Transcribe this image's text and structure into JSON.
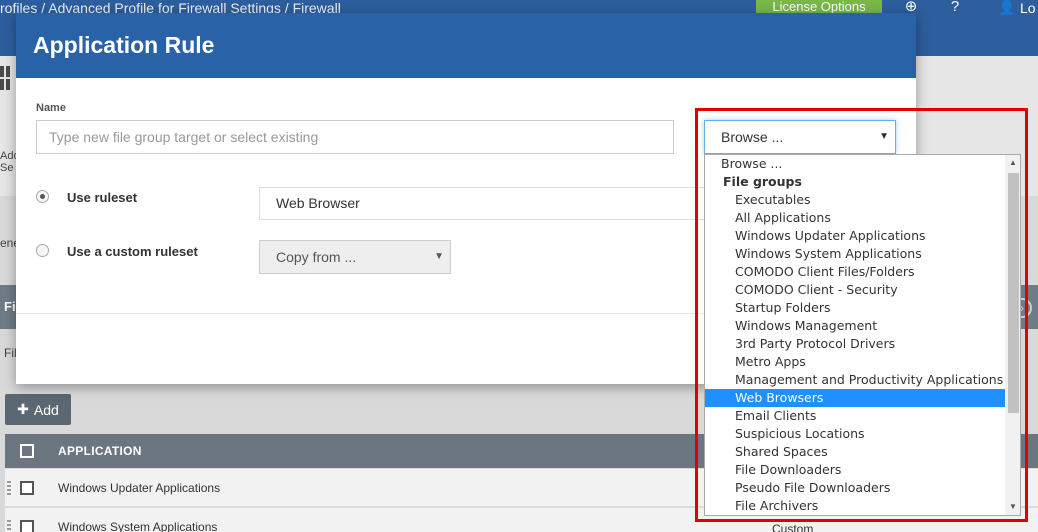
{
  "background": {
    "breadcrumb": "rofiles  /  Advanced Profile for Firewall Settings  /  Firewall",
    "license_button": "License Options",
    "logout_label": "Lo",
    "add_settings_label_line1": "Add",
    "add_settings_label_line2": "Se",
    "general_label": "ene",
    "section_label": "Fi",
    "filter_label": "Fil",
    "add_button": "Add",
    "table": {
      "column_application": "APPLICATION",
      "rows": [
        {
          "name": "Windows Updater Applications",
          "type": ""
        },
        {
          "name": "Windows System Applications",
          "type": "Custom"
        }
      ]
    }
  },
  "modal": {
    "title": "Application Rule",
    "name_label": "Name",
    "name_placeholder": "Type new file group target or select existing",
    "browse_value": "Browse ...",
    "use_ruleset_label": "Use ruleset",
    "ruleset_value": "Web Browser",
    "use_custom_label": "Use a custom ruleset",
    "copy_from_value": "Copy from ..."
  },
  "dropdown": {
    "browse_option": "Browse ...",
    "group_label": "File groups",
    "items": [
      "Executables",
      "All Applications",
      "Windows Updater Applications",
      "Windows System Applications",
      "COMODO Client Files/Folders",
      "COMODO Client - Security",
      "Startup Folders",
      "Windows Management",
      "3rd Party Protocol Drivers",
      "Metro Apps",
      "Management and Productivity Applications",
      "Web Browsers",
      "Email Clients",
      "Suspicious Locations",
      "Shared Spaces",
      "File Downloaders",
      "Pseudo File Downloaders",
      "File Archivers"
    ],
    "selected_item": "Web Browsers"
  },
  "colors": {
    "header_blue": "#2a62a8",
    "topbar_blue": "#2d5e9e",
    "selected_blue": "#1e90ff",
    "annotation_red": "#e00000",
    "license_green": "#7ab84a"
  }
}
